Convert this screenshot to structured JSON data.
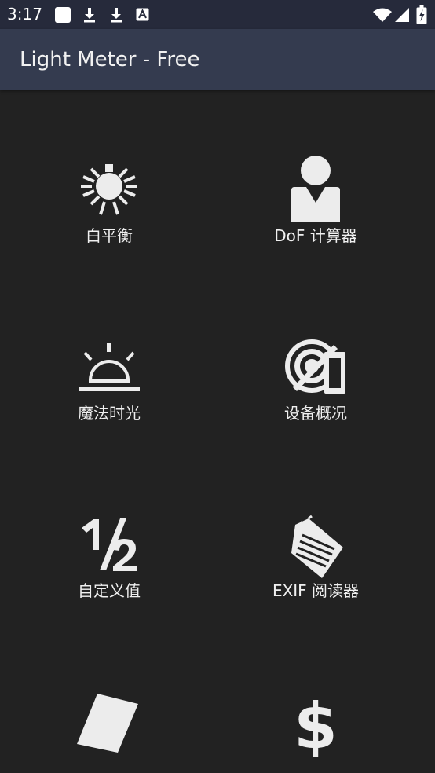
{
  "status_bar": {
    "time": "3:17",
    "left_icons": [
      "square-notification-icon",
      "download-icon",
      "download-icon",
      "font-a-icon"
    ],
    "right_icons": [
      "wifi-icon",
      "signal-icon",
      "battery-icon"
    ]
  },
  "app_bar": {
    "title": "Light Meter - Free"
  },
  "colors": {
    "status_bar_bg": "#262a3b",
    "app_bar_bg": "#343b4f",
    "background": "#222222",
    "icon": "#ececec"
  },
  "tiles": [
    {
      "label": "白平衡",
      "icon": "light-bulb-icon"
    },
    {
      "label": "DoF 计算器",
      "icon": "person-icon"
    },
    {
      "label": "魔法时光",
      "icon": "sunrise-icon"
    },
    {
      "label": "设备概况",
      "icon": "camera-no-flash-icon"
    },
    {
      "label": "自定义值",
      "icon": "one-half-icon"
    },
    {
      "label": "EXIF 阅读器",
      "icon": "tag-icon"
    },
    {
      "label": "",
      "icon": "parallelogram-icon"
    },
    {
      "label": "",
      "icon": "dollar-icon"
    }
  ]
}
